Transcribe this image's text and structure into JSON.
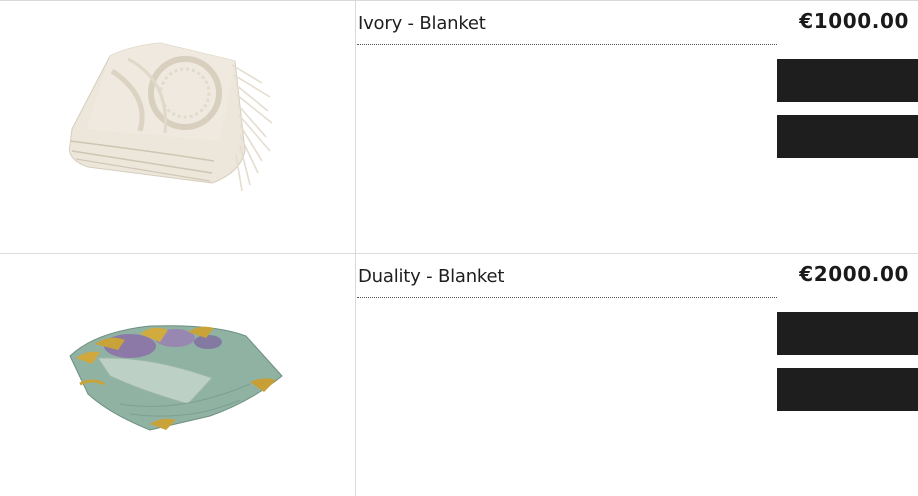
{
  "products": [
    {
      "name": "Ivory - Blanket",
      "price": "€1000.00",
      "image_alt": "ivory-blanket-image",
      "primary_action_label": "",
      "secondary_action_label": ""
    },
    {
      "name": "Duality - Blanket",
      "price": "€2000.00",
      "image_alt": "duality-blanket-image",
      "primary_action_label": "",
      "secondary_action_label": ""
    }
  ],
  "colors": {
    "button_bg": "#1e1e1e",
    "divider": "#d9d9d9",
    "ivory": "#e8e1d5",
    "duality_green": "#8fb2a3",
    "duality_gold": "#c9a23a",
    "duality_purple": "#8c6fa8"
  }
}
